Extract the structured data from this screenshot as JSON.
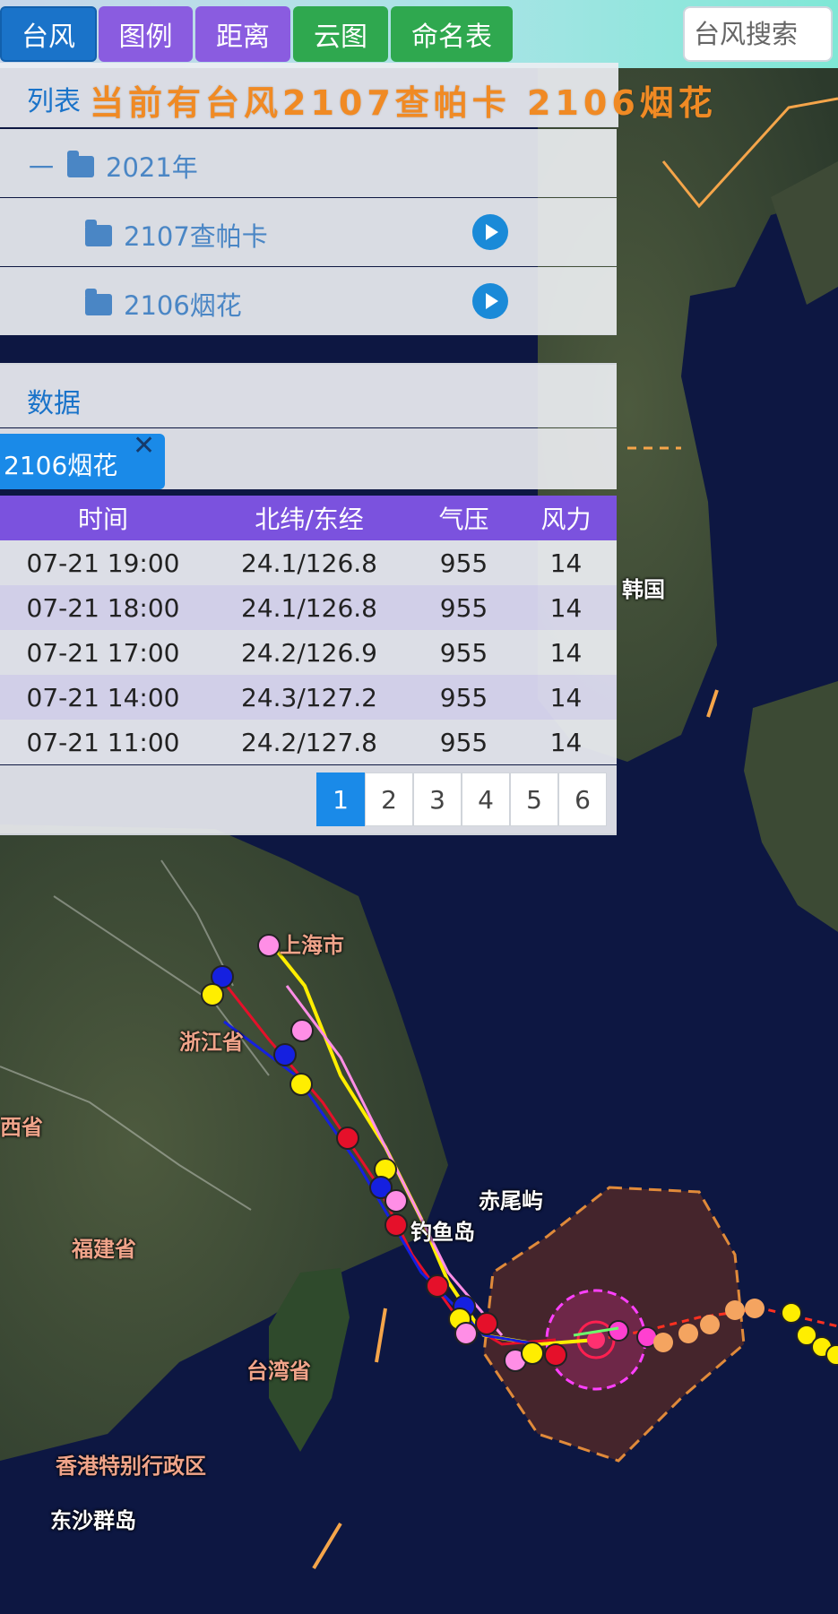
{
  "toolbar": {
    "typhoon": "台风",
    "legend": "图例",
    "distance": "距离",
    "cloud": "云图",
    "names": "命名表",
    "search_placeholder": "台风搜索"
  },
  "list": {
    "label": "列表",
    "marquee": "当前有台风2107查帕卡  2106烟花",
    "year": {
      "toggle": "一",
      "label": "2021年"
    },
    "typhoons": [
      {
        "label": "2107查帕卡"
      },
      {
        "label": "2106烟花"
      }
    ]
  },
  "data_panel": {
    "label": "数据",
    "tag": "2106烟花",
    "tag_close": "✕",
    "columns": [
      "时间",
      "北纬/东经",
      "气压",
      "风力"
    ],
    "rows": [
      [
        "07-21 19:00",
        "24.1/126.8",
        "955",
        "14"
      ],
      [
        "07-21 18:00",
        "24.1/126.8",
        "955",
        "14"
      ],
      [
        "07-21 17:00",
        "24.2/126.9",
        "955",
        "14"
      ],
      [
        "07-21 14:00",
        "24.3/127.2",
        "955",
        "14"
      ],
      [
        "07-21 11:00",
        "24.2/127.8",
        "955",
        "14"
      ]
    ],
    "pages": [
      "1",
      "2",
      "3",
      "4",
      "5",
      "6"
    ],
    "active_page": "1"
  },
  "map": {
    "labels": {
      "shanghai": "上海市",
      "zhejiang": "浙江省",
      "jiangxi": "西省",
      "fujian": "福建省",
      "taiwan": "台湾省",
      "hongkong": "香港特别行政区",
      "dongsha": "东沙群岛",
      "chiwei": "赤尾屿",
      "diaoyu": "钓鱼岛",
      "korea": "韩国"
    },
    "colors": {
      "land": "#3b4a35",
      "sea": "#0b1438",
      "track_yellow": "#ffee00",
      "track_pink": "#ff8ee6",
      "track_red": "#e5102a",
      "track_blue": "#1520e0",
      "forecast_orange": "#f4a460",
      "wind_circle": "#4a2a2a"
    }
  }
}
